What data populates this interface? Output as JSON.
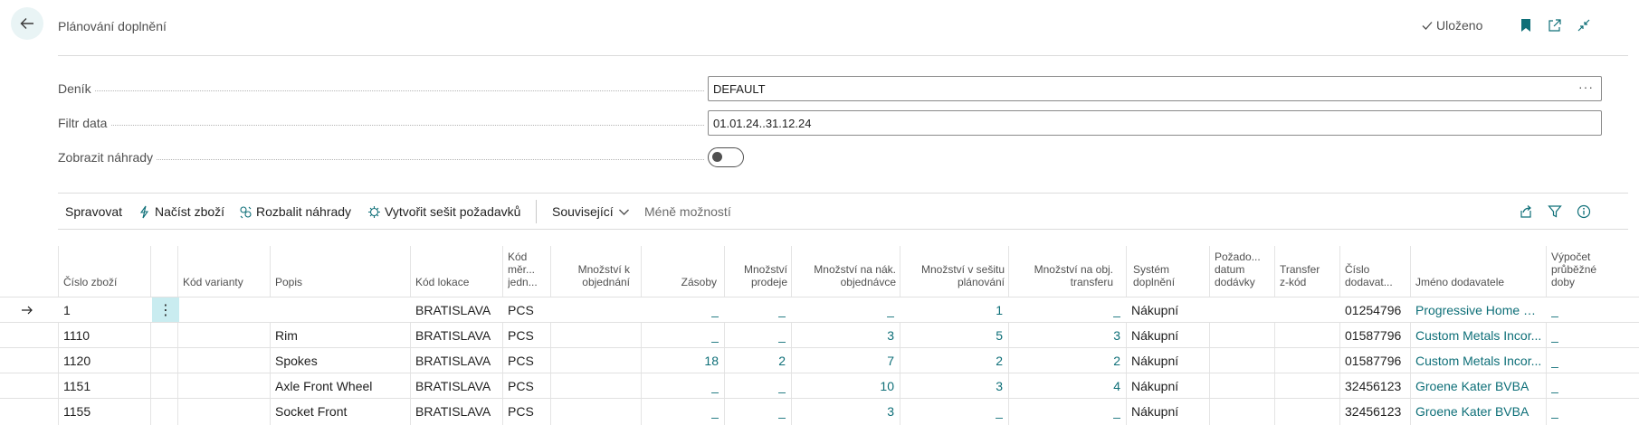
{
  "header": {
    "title": "Plánování doplnění",
    "saved_label": "Uloženo"
  },
  "form": {
    "journal_label": "Deník",
    "journal_value": "DEFAULT",
    "date_filter_label": "Filtr data",
    "date_filter_value": "01.01.24..31.12.24",
    "show_substitutes_label": "Zobrazit náhrady",
    "show_substitutes_on": false
  },
  "actions": {
    "manage": "Spravovat",
    "load_items": "Načíst zboží",
    "expand_substitutes": "Rozbalit náhrady",
    "create_worksheet": "Vytvořit sešit požadavků",
    "related": "Související",
    "fewer_options": "Méně možností"
  },
  "columns": {
    "item_no": "Číslo zboží",
    "variant": "Kód varianty",
    "description": "Popis",
    "location": "Kód lokace",
    "uom": [
      "Kód",
      "měr...",
      "jedn..."
    ],
    "qty_to_order": [
      "Množství k",
      "objednání"
    ],
    "inventory": "Zásoby",
    "qty_sales": [
      "Množství",
      "prodeje"
    ],
    "qty_purch": [
      "Množství na nák.",
      "objednávce"
    ],
    "qty_worksheet": [
      "Množství v sešitu",
      "plánování"
    ],
    "qty_transfer": [
      "Množství na obj.",
      "transferu"
    ],
    "repl_system": [
      "Systém",
      "doplnění"
    ],
    "req_date": [
      "Požado...",
      "datum",
      "dodávky"
    ],
    "transfer_from": [
      "Transfer",
      "z-kód"
    ],
    "vendor_no": [
      "Číslo",
      "dodavat..."
    ],
    "vendor_name": "Jméno dodavatele",
    "lead_time": [
      "Výpočet",
      "průběžné",
      "doby"
    ]
  },
  "rows": [
    {
      "item_no": "1",
      "variant": "",
      "description": "",
      "location": "BRATISLAVA",
      "uom": "PCS",
      "qty_to_order": "",
      "inventory": "_",
      "qty_sales": "_",
      "qty_purch": "_",
      "qty_worksheet": "1",
      "qty_transfer": "_",
      "repl_system": "Nákupní",
      "req_date": "",
      "transfer_from": "",
      "vendor_no": "01254796",
      "vendor_name": "Progressive Home Fu...",
      "lead_time": "_"
    },
    {
      "item_no": "1110",
      "variant": "",
      "description": "Rim",
      "location": "BRATISLAVA",
      "uom": "PCS",
      "qty_to_order": "",
      "inventory": "_",
      "qty_sales": "_",
      "qty_purch": "3",
      "qty_worksheet": "5",
      "qty_transfer": "3",
      "repl_system": "Nákupní",
      "req_date": "",
      "transfer_from": "",
      "vendor_no": "01587796",
      "vendor_name": "Custom Metals Incor...",
      "lead_time": "_"
    },
    {
      "item_no": "1120",
      "variant": "",
      "description": "Spokes",
      "location": "BRATISLAVA",
      "uom": "PCS",
      "qty_to_order": "",
      "inventory": "18",
      "qty_sales": "2",
      "qty_purch": "7",
      "qty_worksheet": "2",
      "qty_transfer": "2",
      "repl_system": "Nákupní",
      "req_date": "",
      "transfer_from": "",
      "vendor_no": "01587796",
      "vendor_name": "Custom Metals Incor...",
      "lead_time": "_"
    },
    {
      "item_no": "1151",
      "variant": "",
      "description": "Axle Front Wheel",
      "location": "BRATISLAVA",
      "uom": "PCS",
      "qty_to_order": "",
      "inventory": "_",
      "qty_sales": "_",
      "qty_purch": "10",
      "qty_worksheet": "3",
      "qty_transfer": "4",
      "repl_system": "Nákupní",
      "req_date": "",
      "transfer_from": "",
      "vendor_no": "32456123",
      "vendor_name": "Groene Kater BVBA",
      "lead_time": "_"
    },
    {
      "item_no": "1155",
      "variant": "",
      "description": "Socket Front",
      "location": "BRATISLAVA",
      "uom": "PCS",
      "qty_to_order": "",
      "inventory": "_",
      "qty_sales": "_",
      "qty_purch": "3",
      "qty_worksheet": "_",
      "qty_transfer": "_",
      "repl_system": "Nákupní",
      "req_date": "",
      "transfer_from": "",
      "vendor_no": "32456123",
      "vendor_name": "Groene Kater BVBA",
      "lead_time": "_"
    }
  ],
  "colors": {
    "accent": "#0e6f78",
    "selection": "#c9ecf0"
  }
}
